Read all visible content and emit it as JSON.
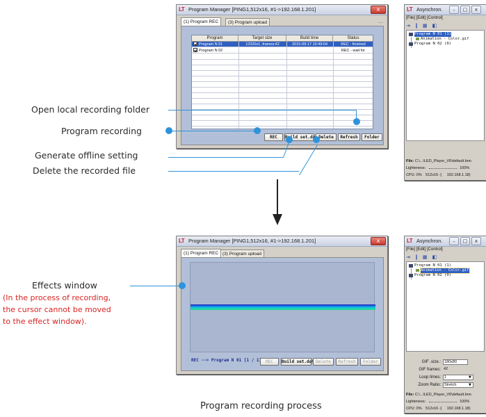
{
  "top_window": {
    "title_logo": "LT",
    "title": "Program Manager  [PING1,512x16, #1->192.168.1.201]",
    "close_glyph": "x",
    "tabs": [
      {
        "label": "(1) Program REC",
        "active": true
      },
      {
        "label": "(3) Program upload",
        "active": false
      }
    ],
    "table": {
      "headers": [
        "Program",
        "Target size",
        "Build time",
        "Status"
      ],
      "rows": [
        {
          "program": "Program N 01",
          "checked": true,
          "target_size": "12320x1 ,frames:42",
          "build_time": "2015-09-17 10:49:04",
          "status": "REC - finished",
          "selected": true
        },
        {
          "program": "Program N 02",
          "checked": true,
          "target_size": "",
          "build_time": "",
          "status": "REC - wait for",
          "selected": false
        }
      ]
    },
    "buttons": {
      "rec": "REC",
      "build": "Build set.dat",
      "delete": "Delete",
      "refresh": "Refresh",
      "folder": "Folder"
    }
  },
  "bottom_window": {
    "title_logo": "LT",
    "title": "Program Manager  [PING1,512x16, #1->192.168.1.201]",
    "close_glyph": "x",
    "tabs": [
      {
        "label": "(1) Program REC",
        "active": true
      },
      {
        "label": "(3) Program upload",
        "active": false
      }
    ],
    "status_text": "REC --> Program N 01   [1 / 1]",
    "buttons": {
      "rec": "REC",
      "build": "Build set.dat",
      "delete": "Delete",
      "refresh": "Refresh",
      "folder": "Folder"
    }
  },
  "async_top": {
    "title_logo": "LT",
    "title": "Asynchron.",
    "menu": "[File]  [Edit]  [Control]",
    "tree": [
      "Program N 01 (1)",
      "Animation - Color.gif",
      "Program N 02 (0)"
    ],
    "file_label": "File:",
    "file_path": "C:\\...\\LED_Player_V6\\default.bnn",
    "lightness_label": "Lighteness:",
    "lightness_value": "100%",
    "cpu": "CPU: 0%",
    "size": "512x16 -[",
    "ip": "192.168.1.18)"
  },
  "async_bottom": {
    "title_logo": "LT",
    "title": "Asynchron.",
    "menu": "[File]  [Edit]  [Control]",
    "tree": [
      "Program N 01 (1)",
      "Animation - Color.gif",
      "Program N 02 (0)"
    ],
    "gif_size_label": "GIF .size.:",
    "gif_size_value": "180x80",
    "gif_frames_label": "GIF frames:",
    "gif_frames_value": "42",
    "loop_times_label": "Loop times:",
    "loop_times_value": "1",
    "zoom_label": "Zoom Ratio:",
    "zoom_value": "Stretch",
    "file_label": "File:",
    "file_path": "C:\\...\\LED_Player_V6\\default.bnn",
    "lightness_label": "Lighteness:",
    "lightness_value": "100%",
    "cpu": "CPU: 0%",
    "size": "512x16 -[",
    "ip": "192.168.1.18)"
  },
  "annotations": {
    "open_folder": "Open local recording folder",
    "program_recording": "Program recording",
    "generate_offline": "Generate offline setting",
    "delete_recorded": "Delete the recorded file",
    "effects_window": "Effects window",
    "effects_note_1": "(In the process of recording,",
    "effects_note_2": "the cursor cannot be moved",
    "effects_note_3": "to the effect window).",
    "caption": "Program recording process"
  },
  "colors": {
    "accent": "#2e93db",
    "note_red": "#d92323",
    "panel": "#b2bfd8",
    "selection": "#2f5fc0"
  }
}
